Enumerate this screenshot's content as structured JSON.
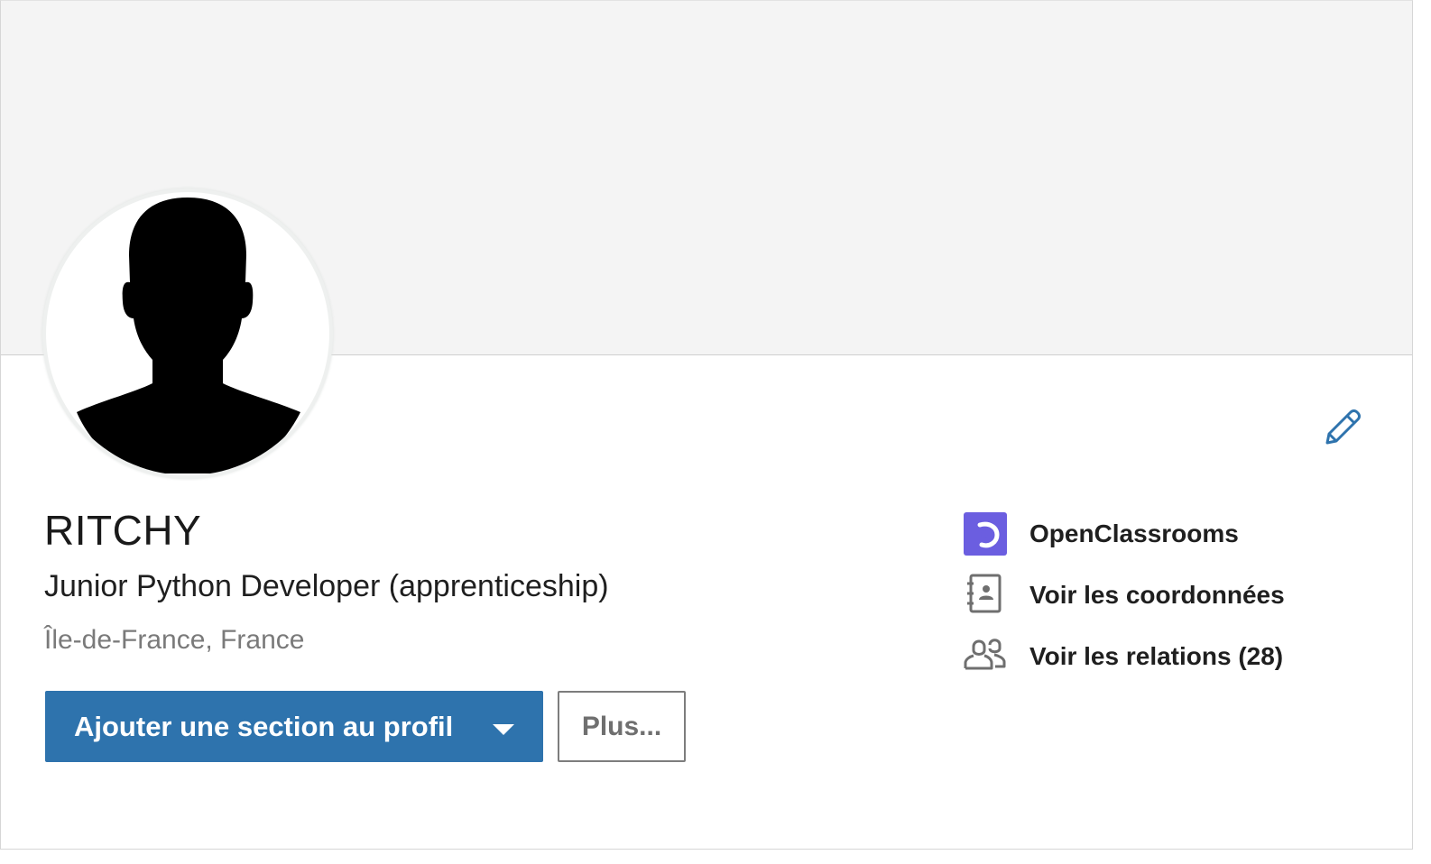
{
  "profile": {
    "name": "RITCHY",
    "headline": "Junior Python Developer (apprenticeship)",
    "location": "Île-de-France, France"
  },
  "actions": {
    "add_section_label": "Ajouter une section au profil",
    "more_label": "Plus..."
  },
  "side": {
    "items": [
      {
        "label": "OpenClassrooms",
        "icon": "openclassrooms-logo"
      },
      {
        "label": "Voir les coordonnées",
        "icon": "contact-book-icon"
      },
      {
        "label": "Voir les relations (28)",
        "icon": "people-icon"
      }
    ]
  },
  "colors": {
    "accent": "#2e73ad",
    "banner": "#f4f4f4",
    "openclassrooms": "#6b5ee0"
  }
}
